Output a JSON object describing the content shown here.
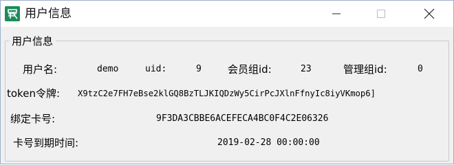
{
  "window": {
    "title": "用户信息",
    "icon": "app-logo-icon",
    "controls": {
      "minimize": "minimize-icon",
      "maximize": "maximize-icon",
      "close": "close-icon"
    }
  },
  "group": {
    "title": "用户信息",
    "username_label": "用户名:",
    "username_value": "demo",
    "uid_label": "uid:",
    "uid_value": "9",
    "member_group_label": "会员组id:",
    "member_group_value": "23",
    "admin_group_label": "管理组id:",
    "admin_group_value": "0",
    "token_label": "token令牌:",
    "token_value": "X9tzC2e7FH7eBse2klGQ8BzTLJKIQDzWy5CirPcJXlnFfnyIc8iyVKmop6]",
    "bind_card_label": "绑定卡号:",
    "bind_card_value": "9F3DA3CBBE6ACEFECA4BC0F4C2E06326",
    "expire_label": "卡号到期时间:",
    "expire_value": "2019-02-28 00:00:00"
  },
  "colors": {
    "title_bg": "#ffffff",
    "body_bg": "#f0f0f0",
    "icon_green": "#1f8a5b"
  }
}
